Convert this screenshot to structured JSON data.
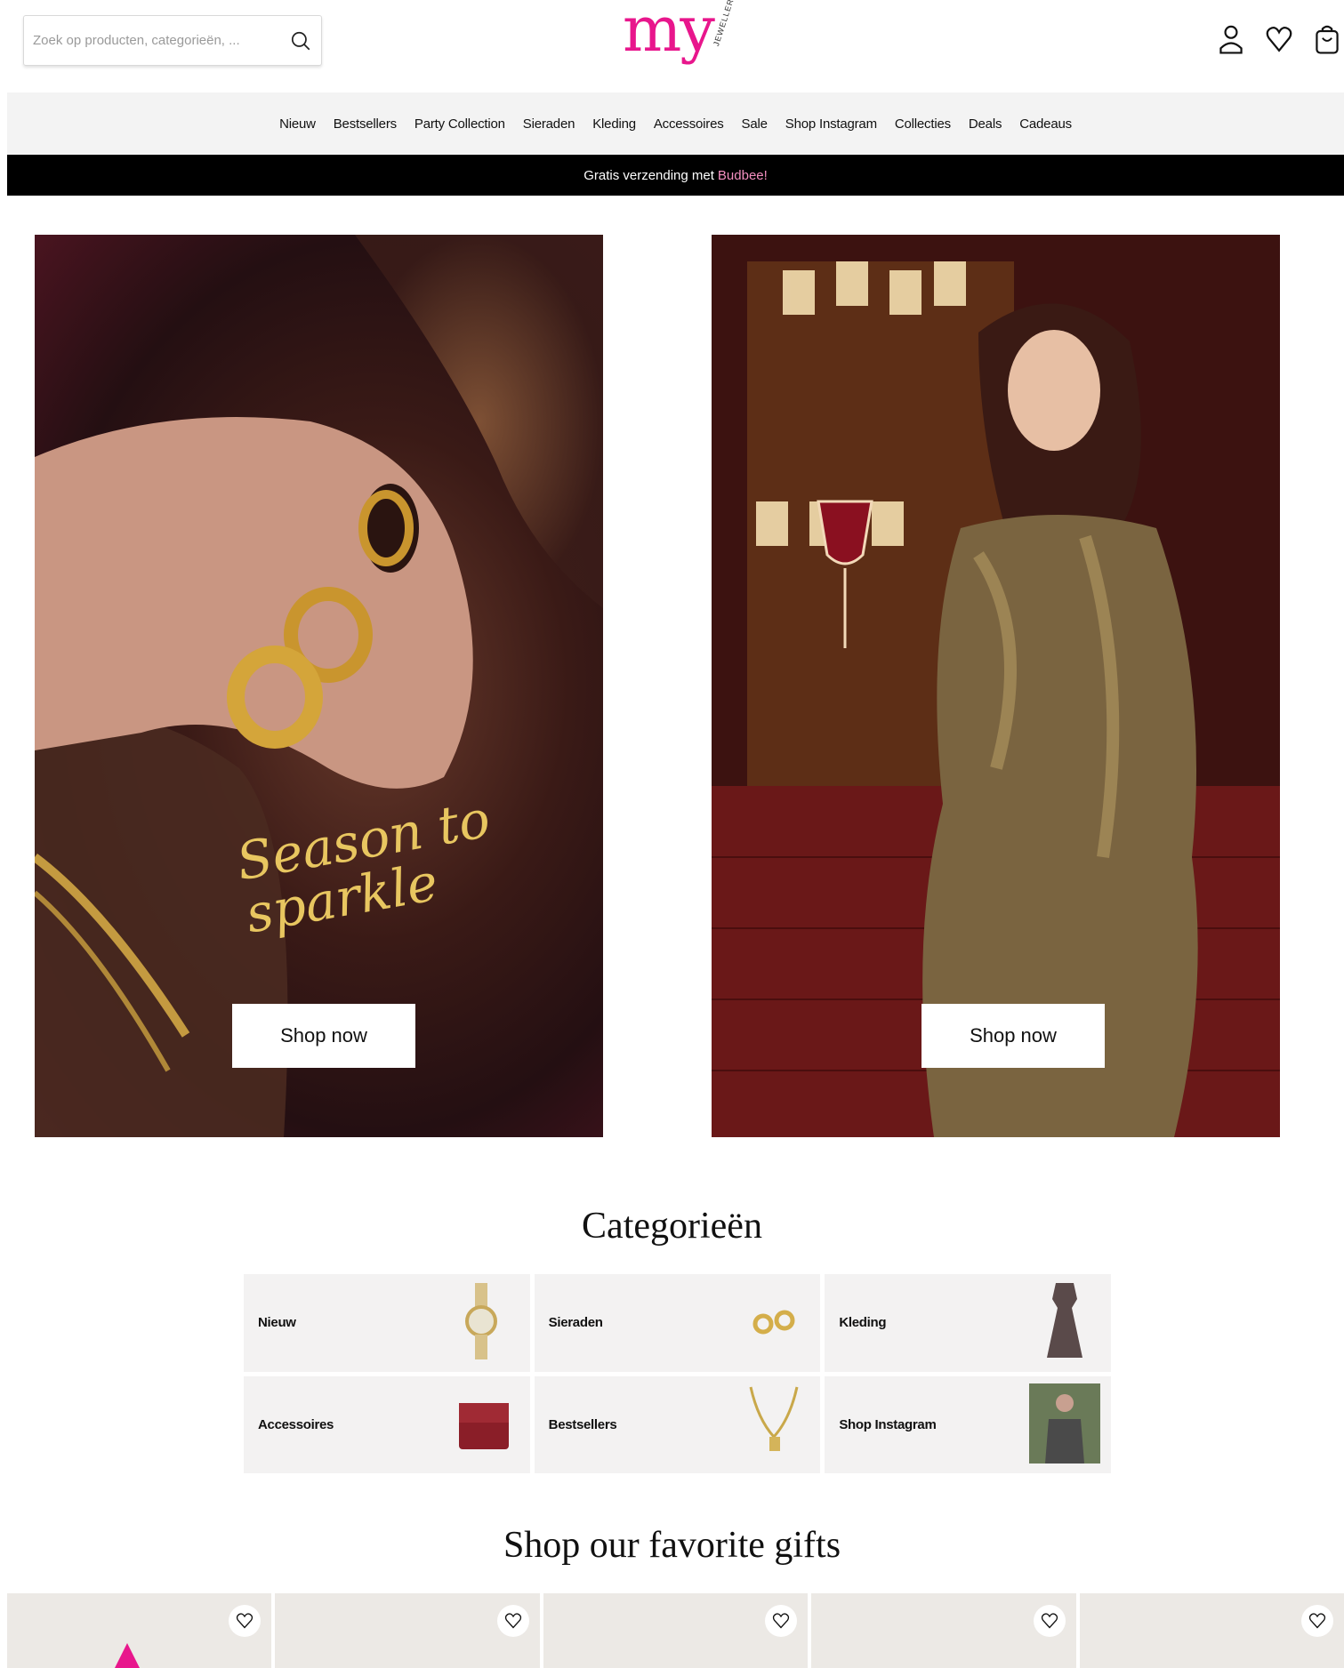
{
  "header": {
    "search_placeholder": "Zoek op producten, categorieën, ...",
    "logo_text": "my",
    "logo_sub": "JEWELLERY",
    "icons": [
      "account-icon",
      "wishlist-heart-icon",
      "shopping-bag-icon"
    ]
  },
  "nav": {
    "items": [
      "Nieuw",
      "Bestsellers",
      "Party Collection",
      "Sieraden",
      "Kleding",
      "Accessoires",
      "Sale",
      "Shop Instagram",
      "Collecties",
      "Deals",
      "Cadeaus"
    ]
  },
  "promo": {
    "text": "Gratis verzending met",
    "highlight": "Budbee!"
  },
  "hero": {
    "left": {
      "script_text": "Season to sparkle",
      "button": "Shop now"
    },
    "right": {
      "button": "Shop now"
    }
  },
  "categories": {
    "title": "Categorieën",
    "items": [
      "Nieuw",
      "Sieraden",
      "Kleding",
      "Accessoires",
      "Bestsellers",
      "Shop Instagram"
    ]
  },
  "gifts": {
    "title": "Shop our favorite gifts"
  },
  "colors": {
    "brand_pink": "#e8168c",
    "promo_accent": "#f48fc0",
    "promo_bg": "#000000",
    "nav_bg": "#f3f3f3"
  }
}
